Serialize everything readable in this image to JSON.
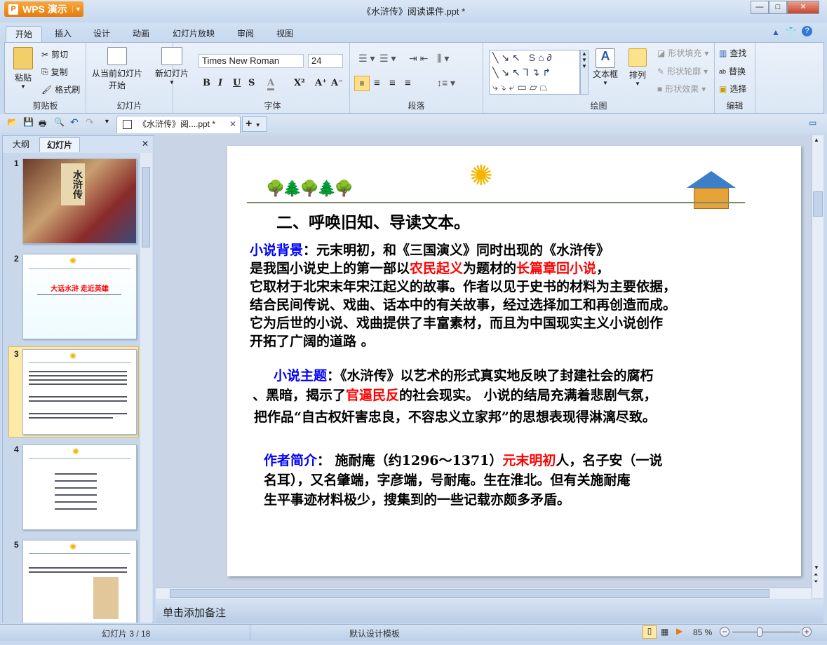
{
  "app": {
    "name": "WPS 演示",
    "title": "《水浒传》阅读课件.ppt *"
  },
  "window": {
    "min": "—",
    "max": "□",
    "close": "✕"
  },
  "tabs": [
    "开始",
    "插入",
    "设计",
    "动画",
    "幻灯片放映",
    "审阅",
    "视图"
  ],
  "ribbon": {
    "clipboard": {
      "label": "剪贴板",
      "paste": "粘贴",
      "cut": "剪切",
      "copy": "复制",
      "format_painter": "格式刷"
    },
    "slides": {
      "label": "幻灯片",
      "from_current": "从当前幻灯片",
      "start": "开始",
      "new_slide": "新幻灯片"
    },
    "font": {
      "label": "字体",
      "family": "Times New Roman",
      "size": "24",
      "bold": "B",
      "italic": "I",
      "underline": "U",
      "strike": "S",
      "color": "A",
      "superscript": "X²",
      "grow": "A⁺",
      "shrink": "A⁻"
    },
    "paragraph": {
      "label": "段落"
    },
    "drawing": {
      "label": "绘图",
      "textbox": "文本框",
      "arrange": "排列",
      "fill": "形状填充",
      "outline": "形状轮廓",
      "effects": "形状效果"
    },
    "editing": {
      "label": "编辑",
      "find": "查找",
      "replace": "替换",
      "select": "选择"
    }
  },
  "doc_tab": {
    "label": "《水浒传》阅....ppt *",
    "close": "✕",
    "new": "+"
  },
  "left_panel": {
    "tabs": [
      "大纲",
      "幻灯片"
    ],
    "close": "✕",
    "thumbs": [
      {
        "num": "1"
      },
      {
        "num": "2",
        "title": "大话水浒 走近英雄"
      },
      {
        "num": "3"
      },
      {
        "num": "4"
      },
      {
        "num": "5"
      }
    ]
  },
  "slide": {
    "heading": "二、呼唤旧知、导读文本。",
    "bg_label": "小说背景",
    "bg_lines": [
      "：元末明初，和《三国演义》同时出现的《水浒传》",
      "是我国小说史上的第一部以",
      "农民起义",
      "为题材的",
      "长篇章回小说",
      "，",
      "它取材于北宋末年宋江起义的故事。作者以见于史书的材料为主要依据，",
      "结合民间传说、戏曲、话本中的有关故事，经过选择加工和再创造而成。",
      "它为后世的小说、戏曲提供了丰富素材，而且为中国现实主义小说创作",
      "开拓了广阔的道路 。"
    ],
    "theme_label": "小说主题",
    "theme_lines": [
      "：《水浒传》以艺术的形式真实地反映了封建社会的腐朽",
      "、黑暗，揭示了",
      "官逼民反",
      "的社会现实。 小说的结局充满着悲剧气氛，",
      "把作品“自古权奸害忠良，不容忠义立家邦”的思想表现得淋漓尽致。"
    ],
    "author_label": "作者简介",
    "author_lines": [
      "： 施耐庵（约1296～1371）",
      "元末明初",
      "人，名子安（一说",
      "名耳），又名肇端，字彦端，号耐庵。生在淮北。但有关施耐庵",
      "生平事迹材料极少，搜集到的一些记载亦颇多矛盾。"
    ]
  },
  "notes": "单击添加备注",
  "status": {
    "slide": "幻灯片 3 / 18",
    "template": "默认设计模板",
    "zoom": "85 %"
  },
  "colors": {
    "accent": "#e57c0c",
    "blue": "#0000ff",
    "red": "#ff0000"
  }
}
